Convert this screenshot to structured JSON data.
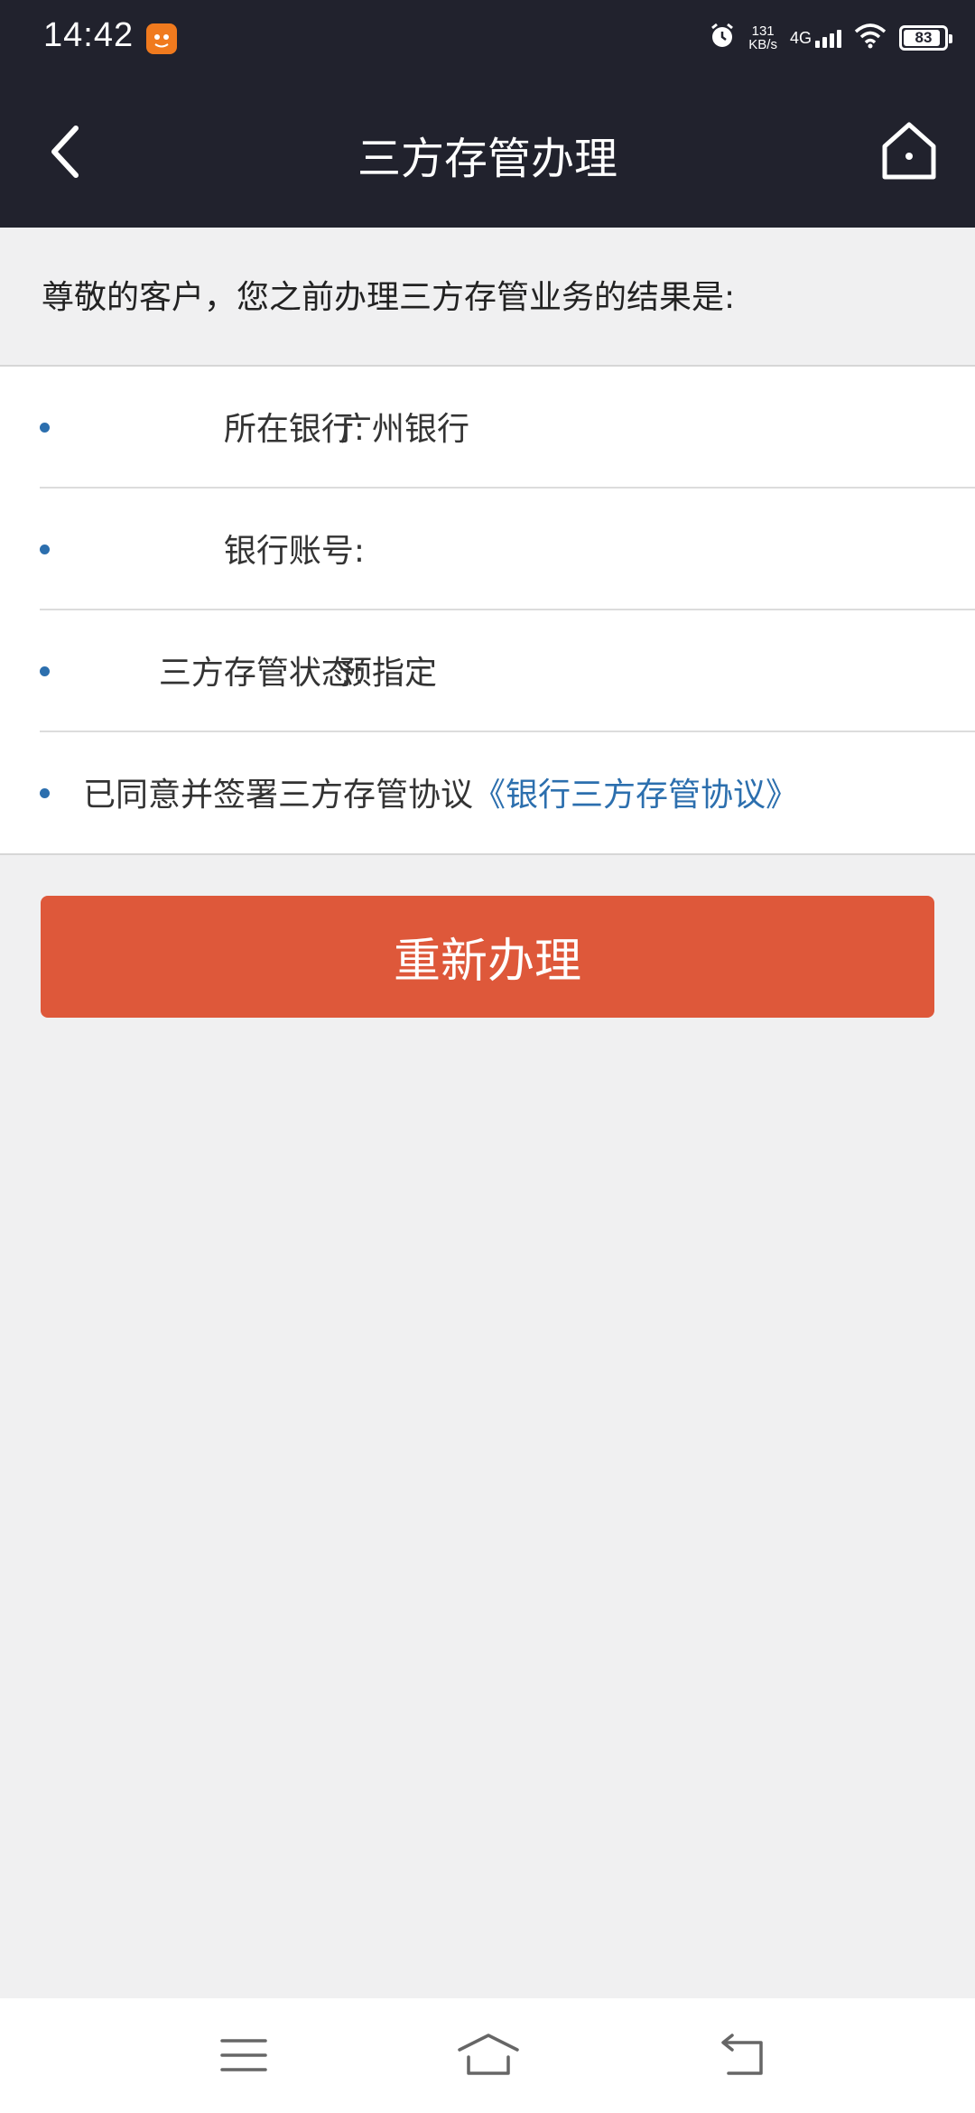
{
  "status_bar": {
    "time": "14:42",
    "speed_value": "131",
    "speed_unit": "KB/s",
    "network": "4G",
    "battery": "83",
    "icons": [
      "app-notification-icon",
      "alarm-icon",
      "signal-icon",
      "wifi-icon",
      "battery-icon"
    ]
  },
  "header": {
    "title": "三方存管办理",
    "back_icon": "back-chevron-icon",
    "home_icon": "home-icon"
  },
  "intro": "尊敬的客户，您之前办理三方存管业务的结果是:",
  "info_rows": [
    {
      "label": "所在银行:",
      "value": "广州银行"
    },
    {
      "label": "银行账号:",
      "value": ""
    },
    {
      "label": "三方存管状态:",
      "value": "预指定"
    }
  ],
  "agreement": {
    "text": "已同意并签署三方存管协议",
    "link": "《银行三方存管协议》"
  },
  "actions": {
    "redo_label": "重新办理"
  },
  "colors": {
    "header_bg": "#21222d",
    "accent_button": "#de583a",
    "link_blue": "#2c6fae",
    "page_bg": "#f0f0f1"
  },
  "nav_bar": {
    "icons": [
      "menu-icon",
      "home-nav-icon",
      "back-nav-icon"
    ]
  }
}
